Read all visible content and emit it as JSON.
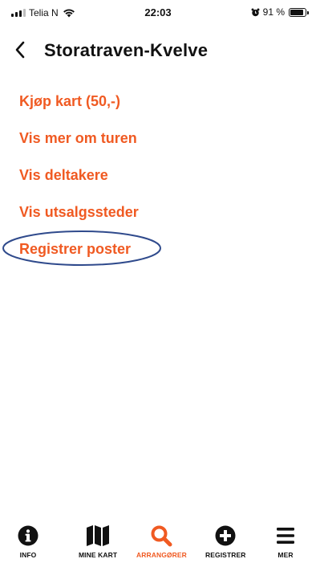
{
  "status_bar": {
    "carrier": "Telia N",
    "time": "22:03",
    "battery": "91 %",
    "battery_level": 0.91
  },
  "header": {
    "title": "Storatraven-Kvelve",
    "back_icon": "chevron-left-icon"
  },
  "menu": {
    "items": [
      {
        "label": "Kjøp kart (50,-)"
      },
      {
        "label": "Vis mer om turen"
      },
      {
        "label": "Vis deltakere"
      },
      {
        "label": "Vis utsalgssteder"
      },
      {
        "label": "Registrer poster"
      }
    ]
  },
  "annotation": {
    "highlighted_item": "Registrer poster",
    "color": "#2f4a8c"
  },
  "tab_bar": {
    "active": "ARRANGØRER",
    "tabs": [
      {
        "label": "INFO",
        "icon": "info-icon"
      },
      {
        "label": "MINE KART",
        "icon": "map-icon"
      },
      {
        "label": "ARRANGØRER",
        "icon": "search-icon"
      },
      {
        "label": "REGISTRER",
        "icon": "plus-circle-icon"
      },
      {
        "label": "MER",
        "icon": "menu-icon"
      }
    ]
  },
  "colors": {
    "accent": "#f05a22",
    "text": "#111111",
    "background": "#ffffff"
  }
}
